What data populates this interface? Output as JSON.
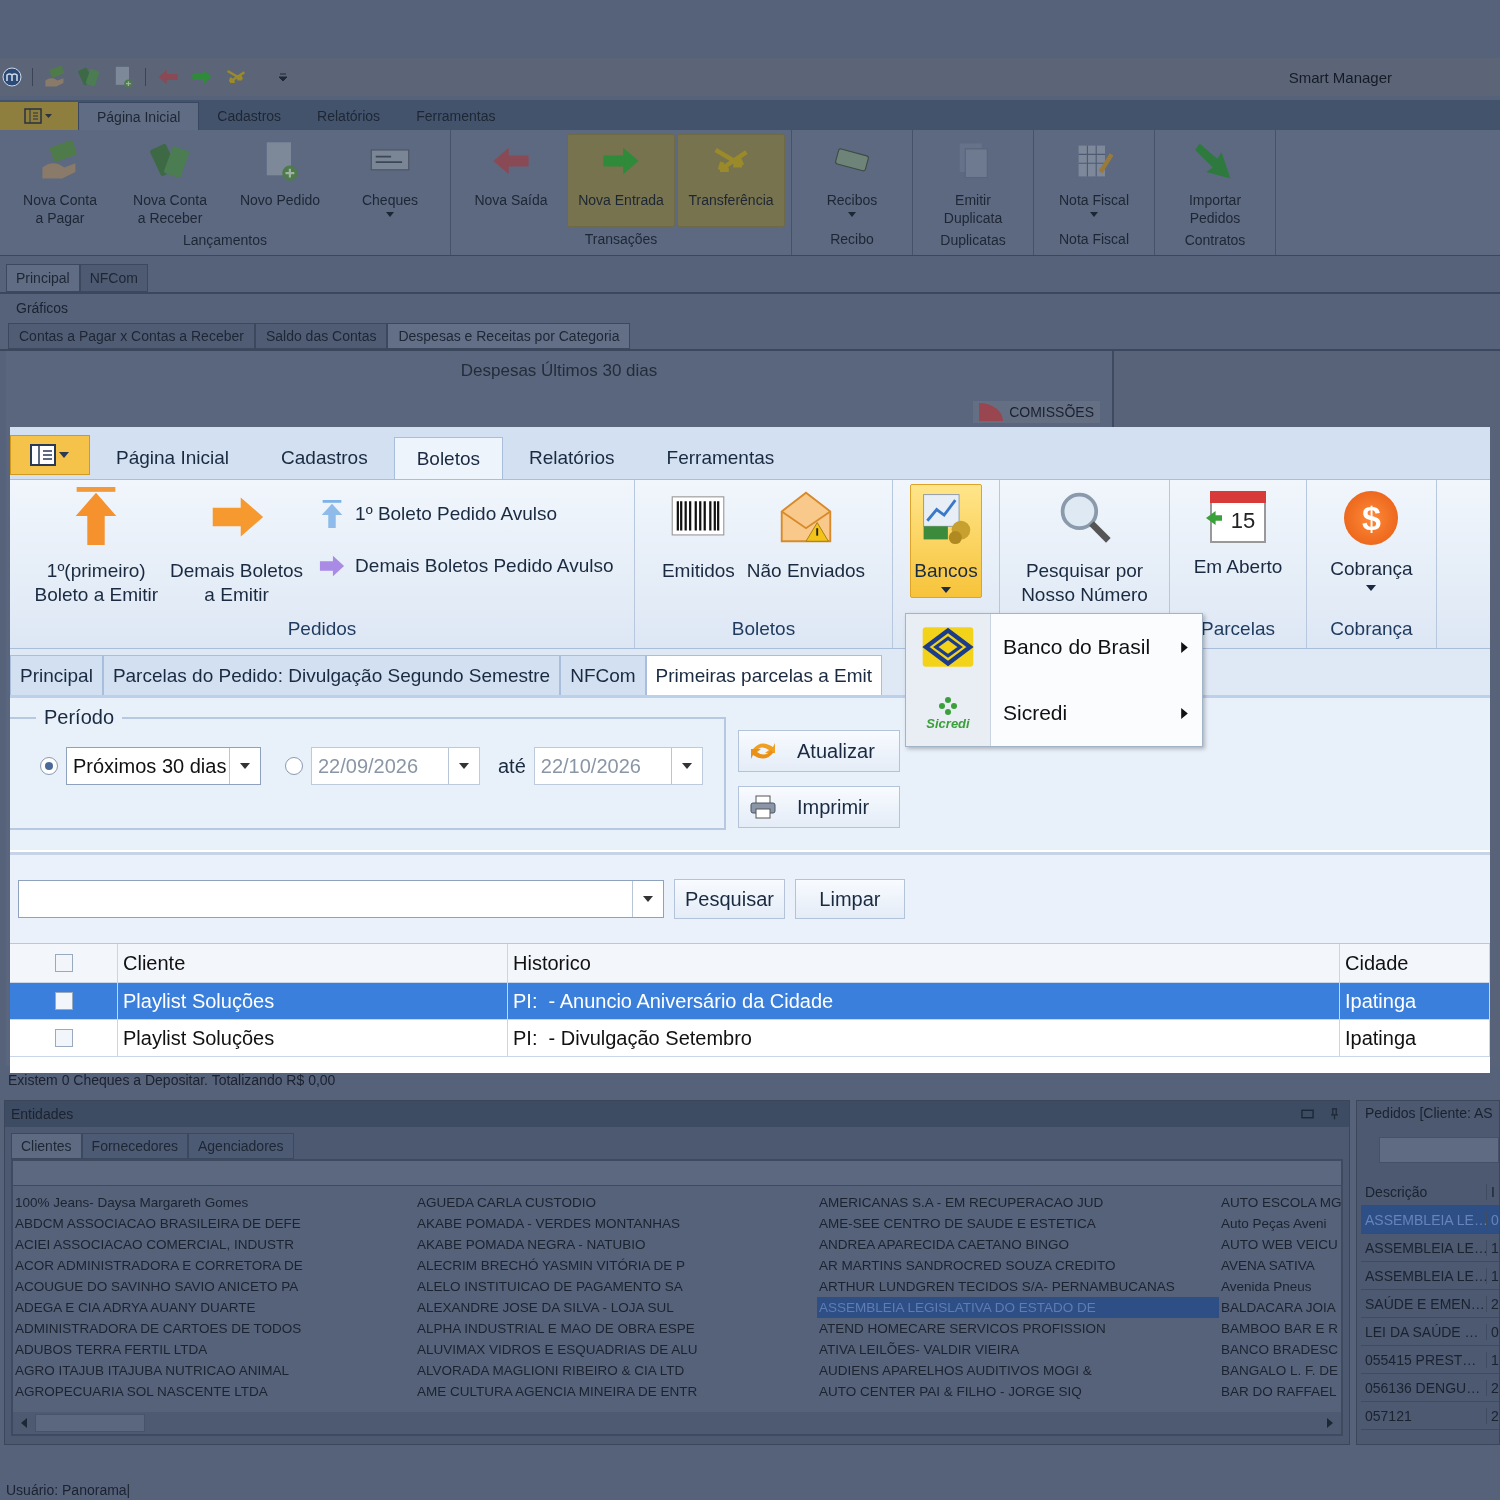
{
  "window": {
    "title": "Smart Manager"
  },
  "ribbon": {
    "tabs": [
      {
        "label": "Página Inicial",
        "selected": true
      },
      {
        "label": "Cadastros",
        "selected": false
      },
      {
        "label": "Relatórios",
        "selected": false
      },
      {
        "label": "Ferramentas",
        "selected": false
      }
    ],
    "groups": [
      {
        "label": "Lançamentos",
        "buttons": [
          {
            "lines": [
              "Nova Conta",
              "a Pagar"
            ],
            "dropdown": false,
            "highlighted": false
          },
          {
            "lines": [
              "Nova Conta",
              "a Receber"
            ],
            "dropdown": false,
            "highlighted": false
          },
          {
            "lines": [
              "Novo Pedido"
            ],
            "dropdown": false,
            "highlighted": false
          },
          {
            "lines": [
              "Cheques"
            ],
            "dropdown": true,
            "highlighted": false
          }
        ]
      },
      {
        "label": "Transações",
        "buttons": [
          {
            "lines": [
              "Nova Saída"
            ],
            "dropdown": false,
            "highlighted": false
          },
          {
            "lines": [
              "Nova Entrada"
            ],
            "dropdown": false,
            "highlighted": true
          },
          {
            "lines": [
              "Transferência"
            ],
            "dropdown": false,
            "highlighted": true
          }
        ]
      },
      {
        "label": "Recibo",
        "buttons": [
          {
            "lines": [
              "Recibos"
            ],
            "dropdown": true,
            "highlighted": false
          }
        ]
      },
      {
        "label": "Duplicatas",
        "buttons": [
          {
            "lines": [
              "Emitir",
              "Duplicata"
            ],
            "dropdown": false,
            "highlighted": false
          }
        ]
      },
      {
        "label": "Nota Fiscal",
        "buttons": [
          {
            "lines": [
              "Nota Fiscal"
            ],
            "dropdown": true,
            "highlighted": false
          }
        ]
      },
      {
        "label": "Contratos",
        "buttons": [
          {
            "lines": [
              "Importar",
              "Pedidos"
            ],
            "dropdown": false,
            "highlighted": false
          }
        ]
      }
    ]
  },
  "document_tabs": [
    {
      "label": "Principal",
      "selected": true
    },
    {
      "label": "NFCom",
      "selected": false
    }
  ],
  "charts_section": {
    "title": "Gráficos",
    "tabs": [
      {
        "label": "Contas a Pagar x Contas a Receber",
        "selected": false
      },
      {
        "label": "Saldo das Contas",
        "selected": false
      },
      {
        "label": "Despesas e Receitas por Categoria",
        "selected": true
      }
    ],
    "chart_title": "Despesas Últimos 30 dias",
    "legend": [
      {
        "label": "COMISSÕES",
        "color": "#9a4650"
      }
    ]
  },
  "info_line": "Existem 0 Cheques a Depositar. Totalizando R$ 0,00",
  "entities": {
    "title": "Entidades",
    "tabs": [
      {
        "label": "Clientes",
        "selected": true
      },
      {
        "label": "Fornecedores",
        "selected": false
      },
      {
        "label": "Agenciadores",
        "selected": false
      }
    ],
    "columns": [
      [
        {
          "name": "100%  Jeans- Daysa Margareth Gomes",
          "selected": false
        },
        {
          "name": "ABDCM ASSOCIACAO BRASILEIRA DE DEFE",
          "selected": false
        },
        {
          "name": "ACIEI ASSOCIACAO COMERCIAL, INDUSTR",
          "selected": false
        },
        {
          "name": "ACOR ADMINISTRADORA E CORRETORA DE",
          "selected": false
        },
        {
          "name": "ACOUGUE DO SAVINHO SAVIO ANICETO PA",
          "selected": false
        },
        {
          "name": "ADEGA E CIA ADRYA AUANY DUARTE",
          "selected": false
        },
        {
          "name": "ADMINISTRADORA DE CARTOES DE TODOS",
          "selected": false
        },
        {
          "name": "ADUBOS TERRA FERTIL LTDA",
          "selected": false
        },
        {
          "name": "AGRO ITAJUB ITAJUBA NUTRICAO ANIMAL",
          "selected": false
        },
        {
          "name": "AGROPECUARIA SOL NASCENTE LTDA",
          "selected": false
        }
      ],
      [
        {
          "name": "AGUEDA CARLA CUSTODIO",
          "selected": false
        },
        {
          "name": "AKABE POMADA - VERDES MONTANHAS",
          "selected": false
        },
        {
          "name": "AKABE POMADA NEGRA - NATUBIO",
          "selected": false
        },
        {
          "name": "ALECRIM BRECHÓ YASMIN VITÓRIA DE P",
          "selected": false
        },
        {
          "name": "ALELO INSTITUICAO DE PAGAMENTO SA",
          "selected": false
        },
        {
          "name": "ALEXANDRE JOSE DA SILVA - LOJA SUL",
          "selected": false
        },
        {
          "name": "ALPHA INDUSTRIAL E MAO DE OBRA ESPE",
          "selected": false
        },
        {
          "name": "ALUVIMAX VIDROS E ESQUADRIAS DE ALU",
          "selected": false
        },
        {
          "name": "ALVORADA MAGLIONI RIBEIRO & CIA LTD",
          "selected": false
        },
        {
          "name": "AME CULTURA AGENCIA MINEIRA DE ENTR",
          "selected": false
        }
      ],
      [
        {
          "name": "AMERICANAS S.A - EM RECUPERACAO JUD",
          "selected": false
        },
        {
          "name": "AME-SEE CENTRO DE SAUDE E ESTETICA",
          "selected": false
        },
        {
          "name": "ANDREA APARECIDA CAETANO BINGO",
          "selected": false
        },
        {
          "name": "AR MARTINS SANDROCRED SOUZA CREDITO",
          "selected": false
        },
        {
          "name": "ARTHUR LUNDGREN TECIDOS S/A- PERNAMBUCANAS",
          "selected": false
        },
        {
          "name": "ASSEMBLEIA LEGISLATIVA DO ESTADO DE",
          "selected": true
        },
        {
          "name": "ATEND HOMECARE  SERVICOS PROFISSION",
          "selected": false
        },
        {
          "name": "ATIVA LEILÕES- VALDIR VIEIRA",
          "selected": false
        },
        {
          "name": "AUDIENS APARELHOS AUDITIVOS MOGI &",
          "selected": false
        },
        {
          "name": "AUTO CENTER PAI & FILHO - JORGE SIQ",
          "selected": false
        }
      ],
      [
        {
          "name": "AUTO ESCOLA MG",
          "selected": false
        },
        {
          "name": "Auto Peças Aveni",
          "selected": false
        },
        {
          "name": "AUTO WEB VEICU",
          "selected": false
        },
        {
          "name": "AVENA SATIVA",
          "selected": false
        },
        {
          "name": "Avenida Pneus",
          "selected": false
        },
        {
          "name": "BALDACARA JOIA",
          "selected": false
        },
        {
          "name": "BAMBOO BAR E R",
          "selected": false
        },
        {
          "name": "BANCO BRADESC",
          "selected": false
        },
        {
          "name": "BANGALO L. F. DE",
          "selected": false
        },
        {
          "name": "BAR DO RAFFAEL",
          "selected": false
        }
      ]
    ]
  },
  "orders": {
    "title": "Pedidos [Cliente: AS",
    "columns": [
      "Descrição",
      "I"
    ],
    "rows": [
      {
        "cells": [
          "ASSEMBLEIA LE…",
          "0"
        ],
        "selected": true
      },
      {
        "cells": [
          "ASSEMBLEIA LE…",
          "1"
        ],
        "selected": false
      },
      {
        "cells": [
          "ASSEMBLEIA LE…",
          "1"
        ],
        "selected": false
      },
      {
        "cells": [
          "SAÚDE E EMEN…",
          "2"
        ],
        "selected": false
      },
      {
        "cells": [
          "LEI DA SAÚDE …",
          "0"
        ],
        "selected": false
      },
      {
        "cells": [
          "055415 PREST…",
          "1"
        ],
        "selected": false
      },
      {
        "cells": [
          "056136 DENGU…",
          "2"
        ],
        "selected": false
      },
      {
        "cells": [
          "057121",
          "2"
        ],
        "selected": false
      }
    ]
  },
  "status_bar": {
    "user": "Usuário: Panorama|"
  },
  "zoom_panel": {
    "tabs": [
      {
        "label": "Página Inicial",
        "selected": false
      },
      {
        "label": "Cadastros",
        "selected": false
      },
      {
        "label": "Boletos",
        "selected": true
      },
      {
        "label": "Relatórios",
        "selected": false
      },
      {
        "label": "Ferramentas",
        "selected": false
      }
    ],
    "groups": [
      {
        "label": "Pedidos",
        "buttons": [
          {
            "kind": "large",
            "lines": [
              "1º(primeiro)",
              "Boleto a Emitir"
            ],
            "dropdown": false,
            "open": false
          },
          {
            "kind": "large",
            "lines": [
              "Demais Boletos",
              "a Emitir"
            ],
            "dropdown": false,
            "open": false
          },
          {
            "kind": "small",
            "lines": [
              "1º Boleto Pedido Avulso"
            ],
            "dropdown": false,
            "open": false
          },
          {
            "kind": "small",
            "lines": [
              "Demais Boletos Pedido Avulso"
            ],
            "dropdown": false,
            "open": false
          }
        ]
      },
      {
        "label": "Boletos",
        "buttons": [
          {
            "kind": "large",
            "lines": [
              "Emitidos"
            ],
            "dropdown": false,
            "open": false
          },
          {
            "kind": "large",
            "lines": [
              "Não Enviados"
            ],
            "dropdown": false,
            "open": false
          }
        ]
      },
      {
        "buttons": [
          {
            "kind": "large",
            "lines": [
              "Bancos"
            ],
            "dropdown": true,
            "open": true
          }
        ]
      },
      {
        "buttons": [
          {
            "kind": "large",
            "lines": [
              "Pesquisar por",
              "Nosso Número"
            ],
            "dropdown": false,
            "open": false
          }
        ]
      },
      {
        "label": "Parcelas",
        "buttons": [
          {
            "kind": "large",
            "lines": [
              "Em Aberto"
            ],
            "dropdown": false,
            "open": false,
            "icon_text": "15"
          }
        ]
      },
      {
        "label": "Cobrança",
        "buttons": [
          {
            "kind": "large",
            "lines": [
              "Cobrança"
            ],
            "dropdown": true,
            "open": false,
            "icon_text": "$"
          }
        ]
      }
    ],
    "menu": [
      {
        "label": "Banco do Brasil",
        "submenu": true
      },
      {
        "label": "Sicredi",
        "submenu": true,
        "logo_text": "Sicredi"
      }
    ],
    "document_tabs": [
      {
        "label": "Principal",
        "selected": false
      },
      {
        "label": "Parcelas do Pedido: Divulgação Segundo Semestre",
        "selected": false
      },
      {
        "label": "NFCom",
        "selected": false
      },
      {
        "label": "Primeiras parcelas a Emit",
        "selected": true
      }
    ],
    "period": {
      "title": "Período",
      "options": [
        {
          "kind": "preset",
          "selected": true,
          "value": "Próximos 30 dias"
        },
        {
          "kind": "range",
          "selected": false,
          "from": "22/09/2026",
          "separator": "até",
          "to": "22/10/2026"
        }
      ]
    },
    "actions": [
      "Atualizar",
      "Imprimir"
    ],
    "search_buttons": [
      "Pesquisar",
      "Limpar"
    ],
    "grid": {
      "all_checked": false,
      "columns": [
        "Cliente",
        "Historico",
        "Cidade"
      ],
      "rows": [
        {
          "selected": true,
          "checked": false,
          "cells": [
            "Playlist Soluções",
            "PI:  - Anuncio Aniversário da Cidade",
            "Ipatinga"
          ]
        },
        {
          "selected": false,
          "checked": false,
          "cells": [
            "Playlist Soluções",
            "PI:  - Divulgação Setembro",
            "Ipatinga"
          ]
        }
      ]
    }
  }
}
